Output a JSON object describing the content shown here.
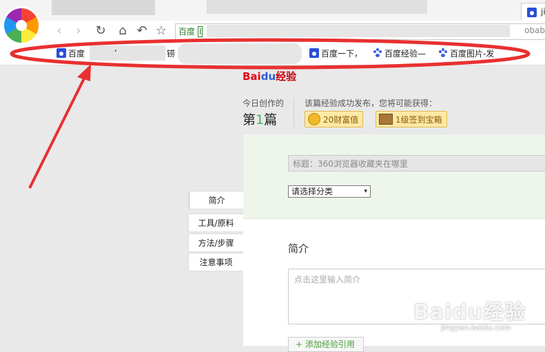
{
  "browser": {
    "tab_title": "ji",
    "address_prefix": "百度",
    "address_suffix": "obab",
    "address_cursor": "I"
  },
  "bookmarks": [
    {
      "label": "百度"
    },
    {
      "label": "百度一下，"
    },
    {
      "label": "百度经验—"
    },
    {
      "label": "百度图片-发"
    }
  ],
  "bookmark_fragments": [
    "ʻ",
    "铹"
  ],
  "page": {
    "brand": {
      "bai": "Bai",
      "du": "du",
      "jingyan": "经验"
    },
    "today_label": "今日创作的",
    "count_pre": "第",
    "count_num": "1",
    "count_post": "篇",
    "reward_text": "该篇经验成功发布，您将可能获得：",
    "reward_wealth": "20财富值",
    "reward_box": "1级签到宝箱",
    "title_placeholder": "标题：360浏览器收藏夹在哪里",
    "category_select": "请选择分类",
    "sidebar": [
      "简介",
      "工具/原料",
      "方法/步骤",
      "注意事项"
    ],
    "intro_heading": "简介",
    "intro_placeholder": "点击这里输入简介",
    "add_ref": "+ 添加经验引用"
  },
  "watermark": {
    "text": "Baidu经验",
    "url": "jingyan.baidu.com"
  },
  "colors": {
    "highlight": "#e83030",
    "accent_green": "#4caf50",
    "title_bg": "#eef6ec"
  }
}
